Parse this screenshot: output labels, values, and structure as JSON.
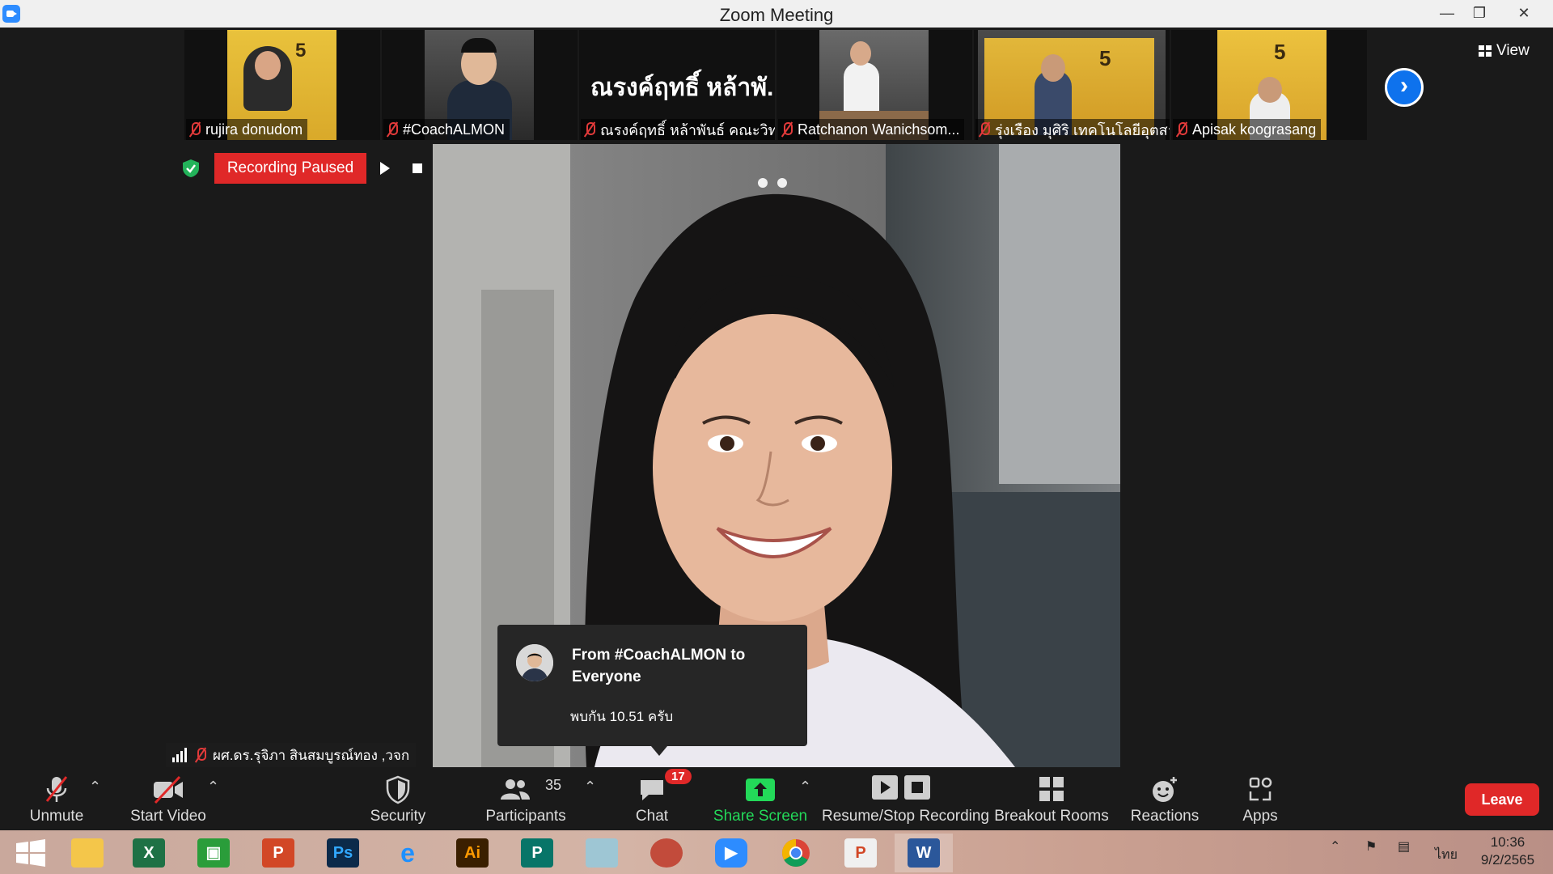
{
  "window": {
    "title": "Zoom Meeting"
  },
  "thumbnails": [
    {
      "name": "rujira donudom"
    },
    {
      "name": "#CoachALMON"
    },
    {
      "name": "ณรงค์ฤทธิ์ หล้าพันธ์ คณะวิทย์",
      "tile_text": "ณรงค์ฤทธิ์ หล้าพั..."
    },
    {
      "name": "Ratchanon Wanichsom..."
    },
    {
      "name": "รุ่งเรือง มุศิริ เทคโนโลยีอุตสา..."
    },
    {
      "name": "Apisak koograsang"
    }
  ],
  "view_button": {
    "label": "View"
  },
  "recording": {
    "status": "Recording Paused"
  },
  "speaker": {
    "name": "ผศ.ดร.รุจิภา สินสมบูรณ์ทอง ,วจก"
  },
  "chat_popup": {
    "from": "From #CoachALMON to Everyone",
    "message": "พบกัน 10.51 ครับ"
  },
  "toolbar": {
    "unmute": "Unmute",
    "start_video": "Start Video",
    "security": "Security",
    "participants": "Participants",
    "participants_count": "35",
    "chat": "Chat",
    "chat_badge": "17",
    "share_screen": "Share Screen",
    "recording": "Resume/Stop Recording",
    "breakout": "Breakout Rooms",
    "reactions": "Reactions",
    "apps": "Apps",
    "leave": "Leave"
  },
  "taskbar": {
    "apps": [
      "windows-start",
      "file-explorer",
      "excel",
      "store",
      "powerpoint",
      "photoshop",
      "internet-explorer",
      "illustrator",
      "publisher",
      "notes",
      "photoscape",
      "zoom",
      "chrome",
      "powerpoint-viewer",
      "word"
    ],
    "language": "ไทย",
    "time": "10:36",
    "date": "9/2/2565"
  },
  "colors": {
    "accent": "#0e72ed",
    "danger": "#e02828",
    "share_green": "#23d959",
    "toolbar_bg": "#1a1a1a"
  }
}
